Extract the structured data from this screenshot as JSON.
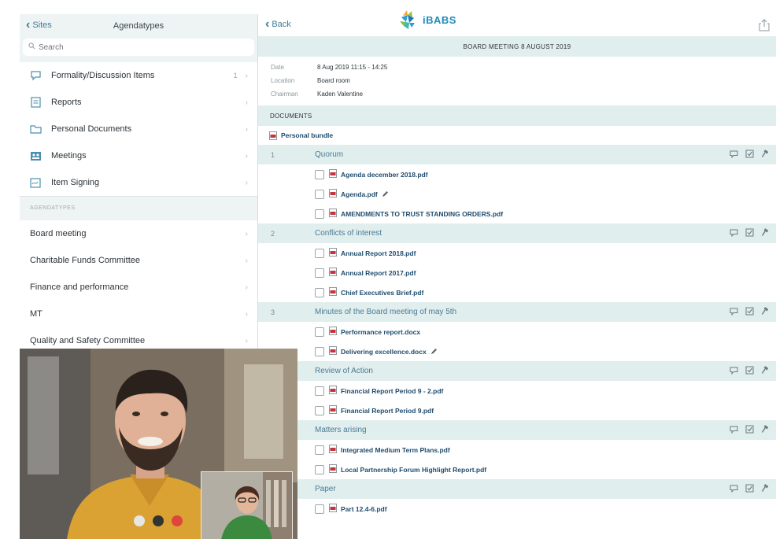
{
  "left": {
    "back_label": "Sites",
    "title": "Agendatypes",
    "search_placeholder": "Search",
    "nav_items": [
      {
        "label": "Formality/Discussion Items",
        "meta": "1"
      },
      {
        "label": "Reports"
      },
      {
        "label": "Personal Documents"
      },
      {
        "label": "Meetings"
      },
      {
        "label": "Item Signing"
      }
    ],
    "section_label": "AGENDATYPES",
    "agendatypes": [
      {
        "label": "Board meeting"
      },
      {
        "label": "Charitable Funds Committee"
      },
      {
        "label": "Finance and performance"
      },
      {
        "label": "MT"
      },
      {
        "label": "Quality and Safety Committee"
      }
    ]
  },
  "header": {
    "back_label": "Back",
    "brand": "iBABS",
    "meeting_title": "BOARD MEETING 8 AUGUST 2019"
  },
  "meeting": {
    "date_label": "Date",
    "date_value": "8 Aug 2019 11:15 - 14:25",
    "location_label": "Location",
    "location_value": "Board room",
    "chairman_label": "Chairman",
    "chairman_value": "Kaden Valentine",
    "documents_header": "DOCUMENTS",
    "personal_bundle": "Personal bundle"
  },
  "agenda": [
    {
      "num": "1",
      "title": "Quorum",
      "docs": [
        {
          "name": "Agenda december 2018.pdf"
        },
        {
          "name": "Agenda.pdf",
          "edited": true
        },
        {
          "name": "AMENDMENTS TO TRUST STANDING ORDERS.pdf"
        }
      ]
    },
    {
      "num": "2",
      "title": "Conflicts of interest",
      "docs": [
        {
          "name": "Annual Report 2018.pdf"
        },
        {
          "name": "Annual Report 2017.pdf"
        },
        {
          "name": "Chief Executives Brief.pdf"
        }
      ]
    },
    {
      "num": "3",
      "title": "Minutes of the Board meeting of may 5th",
      "docs": [
        {
          "name": "Performance report.docx"
        },
        {
          "name": "Delivering excellence.docx",
          "edited": true
        }
      ]
    },
    {
      "num": "",
      "title": "Review of Action",
      "docs": [
        {
          "name": "Financial Report Period 9 - 2.pdf"
        },
        {
          "name": "Financial Report Period 9.pdf"
        }
      ]
    },
    {
      "num": "",
      "title": "Matters arising",
      "docs": [
        {
          "name": "Integrated Medium Term Plans.pdf"
        },
        {
          "name": "Local Partnership Forum Highlight Report.pdf"
        }
      ]
    },
    {
      "num": "",
      "title": "Paper",
      "docs": [
        {
          "name": "Part 12.4-6.pdf"
        }
      ]
    }
  ],
  "colors": {
    "accent": "#3f7d96",
    "header_bg": "#e1eeee",
    "sidebar_bg": "#eef4f3",
    "brand": "#1e8bb9",
    "pdf_red": "#c8323a",
    "call_end": "#e0453c"
  },
  "icons": {
    "nav": [
      "speech-bubble-icon",
      "document-icon",
      "folder-icon",
      "meetings-icon",
      "signature-icon"
    ],
    "agenda_actions": [
      "comment-icon",
      "checkbox-icon",
      "hammer-icon"
    ]
  }
}
